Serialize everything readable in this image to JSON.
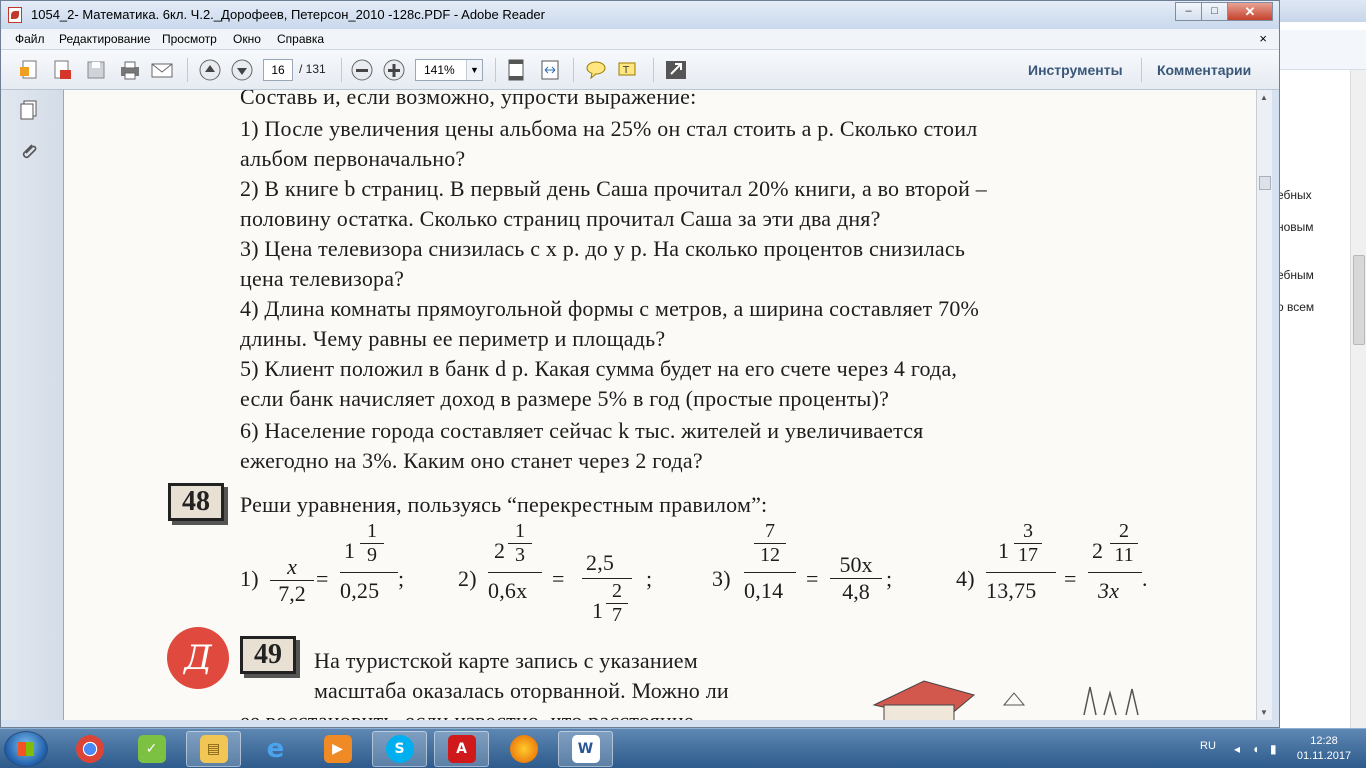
{
  "window": {
    "title": "1054_2- Математика. 6кл. Ч.2._Дорофеев, Петерсон_2010 -128с.PDF - Adobe Reader",
    "controls": {
      "minimize": "–",
      "maximize": "□",
      "close": "✕"
    }
  },
  "menu": [
    "Файл",
    "Редактирование",
    "Просмотр",
    "Окно",
    "Справка"
  ],
  "menu_close": "×",
  "toolbar": {
    "page_current": "16",
    "page_total": "/ 131",
    "zoom": "141%",
    "tools_label": "Инструменты",
    "comments_label": "Комментарии"
  },
  "document": {
    "lines": [
      "Составь и, если возможно, упрости выражение:",
      "1) После увеличения цены альбома на 25% он стал стоить a р. Сколько стоил",
      "альбом первоначально?",
      "2) В книге b страниц. В первый день Саша прочитал 20% книги, а во второй –",
      "половину остатка. Сколько страниц прочитал Саша за эти два дня?",
      "3) Цена телевизора снизилась с x р. до y р. На сколько процентов снизилась",
      "цена телевизора?",
      "4) Длина комнаты прямоугольной формы c метров, а ширина составляет 70%",
      "длины. Чему равны ее периметр и площадь?",
      "5) Клиент положил в банк d р. Какая сумма будет на его счете через 4 года,",
      "если банк начисляет доход в размере 5% в год (простые проценты)?",
      "6) Население города составляет сейчас k тыс. жителей и увеличивается",
      "ежегодно на 3%. Каким оно станет через 2 года?"
    ],
    "task48": {
      "number": "48",
      "text": "Реши уравнения, пользуясь “перекрестным правилом”:",
      "eq1": {
        "label": "1)",
        "n1": "x",
        "d1": "7,2",
        "eq": "=",
        "whole2": "1",
        "fn2": "1",
        "fd2": "9",
        "d2": "0,25",
        "end": ";"
      },
      "eq2": {
        "label": "2)",
        "whole1": "2",
        "fn1": "1",
        "fd1": "3",
        "d1": "0,6x",
        "eq": "=",
        "n2": "2,5",
        "whole2": "1",
        "fn2": "2",
        "fd2": "7",
        "end": ";"
      },
      "eq3": {
        "label": "3)",
        "fn1": "7",
        "fd1": "12",
        "d1": "0,14",
        "eq": "=",
        "n2": "50x",
        "d2": "4,8",
        "end": ";"
      },
      "eq4": {
        "label": "4)",
        "whole1": "1",
        "fn1": "3",
        "fd1": "17",
        "d1": "13,75",
        "eq": "=",
        "whole2": "2",
        "fn2": "2",
        "fd2": "11",
        "d2": "3x",
        "end": "."
      }
    },
    "task49": {
      "badge": "Д",
      "number": "49",
      "lines": [
        "На туристской карте запись с указанием",
        "масштаба оказалась оторванной. Можно ли",
        "ее восстановить, если известно, что расстояние"
      ]
    }
  },
  "background_window": {
    "lines": [
      "ебных",
      "новым",
      "ебным",
      "о всем"
    ]
  },
  "taskbar": {
    "apps": [
      "chrome",
      "gadgets",
      "explorer",
      "internet-explorer",
      "media-player",
      "skype",
      "adobe-reader",
      "firefox",
      "word"
    ],
    "language": "RU",
    "time": "12:28",
    "date": "01.11.2017"
  }
}
